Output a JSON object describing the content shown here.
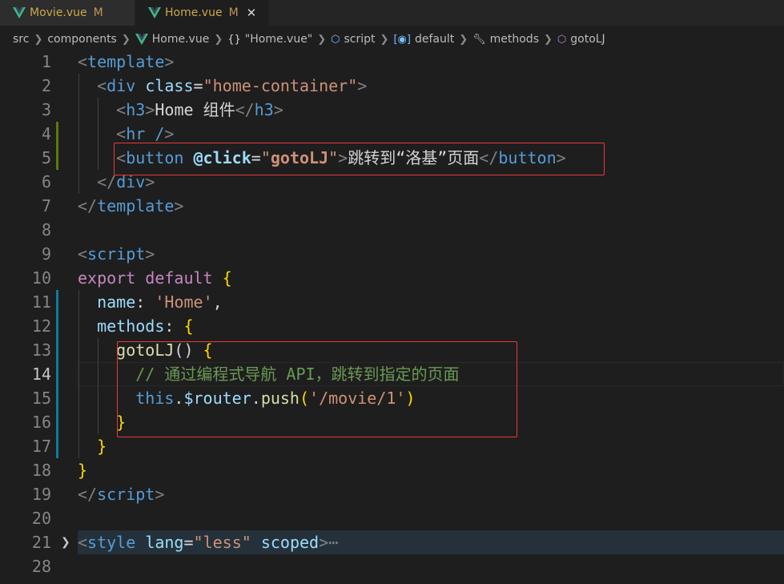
{
  "tabs": [
    {
      "name": "Movie.vue",
      "status": "M"
    },
    {
      "name": "Home.vue",
      "status": "M",
      "close": "✕"
    }
  ],
  "breadcrumb": {
    "src": "src",
    "components": "components",
    "file": "Home.vue",
    "module": "\"Home.vue\"",
    "script": "script",
    "default": "default",
    "methods": "methods",
    "method": "gotoLJ"
  },
  "lines": [
    {
      "num": "1",
      "tokens": [
        [
          "<",
          "punc"
        ],
        [
          "template",
          "tag"
        ],
        [
          ">",
          "punc"
        ]
      ]
    },
    {
      "num": "2",
      "tokens": [
        [
          "  ",
          ""
        ],
        [
          "<",
          "punc"
        ],
        [
          "div",
          "tag"
        ],
        [
          " ",
          ""
        ],
        [
          "class",
          "attr"
        ],
        [
          "=",
          "text"
        ],
        [
          "\"home-container\"",
          "str"
        ],
        [
          ">",
          "punc"
        ]
      ]
    },
    {
      "num": "3",
      "tokens": [
        [
          "    ",
          ""
        ],
        [
          "<",
          "punc"
        ],
        [
          "h3",
          "tag"
        ],
        [
          ">",
          "punc"
        ],
        [
          "Home 组件",
          "text"
        ],
        [
          "</",
          "punc"
        ],
        [
          "h3",
          "tag"
        ],
        [
          ">",
          "punc"
        ]
      ]
    },
    {
      "num": "4",
      "tokens": [
        [
          "    ",
          ""
        ],
        [
          "<",
          "punc"
        ],
        [
          "hr",
          "tag"
        ],
        [
          " /",
          "tag"
        ],
        [
          ">",
          "punc"
        ]
      ]
    },
    {
      "num": "5",
      "tokens": [
        [
          "    ",
          ""
        ],
        [
          "<",
          "punc"
        ],
        [
          "button",
          "tag"
        ],
        [
          " ",
          ""
        ],
        [
          "@click",
          "attrb"
        ],
        [
          "=",
          "text"
        ],
        [
          "\"",
          "str"
        ],
        [
          "gotoLJ",
          "strb"
        ],
        [
          "\"",
          "str"
        ],
        [
          ">",
          "punc"
        ],
        [
          "跳转到“洛基”页面",
          "text"
        ],
        [
          "</",
          "punc"
        ],
        [
          "button",
          "tag"
        ],
        [
          ">",
          "punc"
        ]
      ]
    },
    {
      "num": "6",
      "tokens": [
        [
          "  ",
          ""
        ],
        [
          "</",
          "punc"
        ],
        [
          "div",
          "tag"
        ],
        [
          ">",
          "punc"
        ]
      ]
    },
    {
      "num": "7",
      "tokens": [
        [
          "</",
          "punc"
        ],
        [
          "template",
          "tag"
        ],
        [
          ">",
          "punc"
        ]
      ]
    },
    {
      "num": "8",
      "tokens": []
    },
    {
      "num": "9",
      "tokens": [
        [
          "<",
          "punc"
        ],
        [
          "script",
          "tag"
        ],
        [
          ">",
          "punc"
        ]
      ]
    },
    {
      "num": "10",
      "tokens": [
        [
          "export",
          "kw"
        ],
        [
          " ",
          ""
        ],
        [
          "default",
          "kw"
        ],
        [
          " ",
          ""
        ],
        [
          "{",
          "bracket"
        ]
      ]
    },
    {
      "num": "11",
      "tokens": [
        [
          "  ",
          ""
        ],
        [
          "name",
          "prop"
        ],
        [
          ": ",
          "text"
        ],
        [
          "'Home'",
          "str"
        ],
        [
          ",",
          "text"
        ]
      ]
    },
    {
      "num": "12",
      "tokens": [
        [
          "  ",
          ""
        ],
        [
          "methods",
          "prop"
        ],
        [
          ": ",
          "text"
        ],
        [
          "{",
          "bracket"
        ]
      ]
    },
    {
      "num": "13",
      "tokens": [
        [
          "    ",
          ""
        ],
        [
          "gotoLJ",
          "fn"
        ],
        [
          "() ",
          "text"
        ],
        [
          "{",
          "bracket"
        ]
      ]
    },
    {
      "num": "14",
      "tokens": [
        [
          "      ",
          ""
        ],
        [
          "// 通过编程式导航 API，跳转到指定的页面",
          "comment"
        ]
      ]
    },
    {
      "num": "15",
      "tokens": [
        [
          "      ",
          ""
        ],
        [
          "this",
          "this"
        ],
        [
          ".",
          "text"
        ],
        [
          "$router",
          "var"
        ],
        [
          ".",
          "text"
        ],
        [
          "push",
          "fn"
        ],
        [
          "(",
          "bracket"
        ],
        [
          "'/movie/1'",
          "str"
        ],
        [
          ")",
          "bracket"
        ]
      ]
    },
    {
      "num": "16",
      "tokens": [
        [
          "    ",
          ""
        ],
        [
          "}",
          "bracket"
        ]
      ]
    },
    {
      "num": "17",
      "tokens": [
        [
          "  ",
          ""
        ],
        [
          "}",
          "bracket"
        ]
      ]
    },
    {
      "num": "18",
      "tokens": [
        [
          "}",
          "bracket"
        ]
      ]
    },
    {
      "num": "19",
      "tokens": [
        [
          "</",
          "punc"
        ],
        [
          "script",
          "tag"
        ],
        [
          ">",
          "punc"
        ]
      ]
    },
    {
      "num": "20",
      "tokens": []
    },
    {
      "num": "21",
      "tokens": [
        [
          "<",
          "punc"
        ],
        [
          "style",
          "tag"
        ],
        [
          " ",
          ""
        ],
        [
          "lang",
          "attr"
        ],
        [
          "=",
          "text"
        ],
        [
          "\"less\"",
          "str"
        ],
        [
          " ",
          ""
        ],
        [
          "scoped",
          "attr"
        ],
        [
          ">",
          "punc"
        ],
        [
          "⋯",
          "punc"
        ]
      ]
    },
    {
      "num": "28",
      "tokens": []
    }
  ],
  "colors": {
    "highlight_box": "#e83a3a",
    "modified_gutter": "#0c7d9d",
    "added_gutter": "#587c0c",
    "vue_green": "#41b883"
  }
}
